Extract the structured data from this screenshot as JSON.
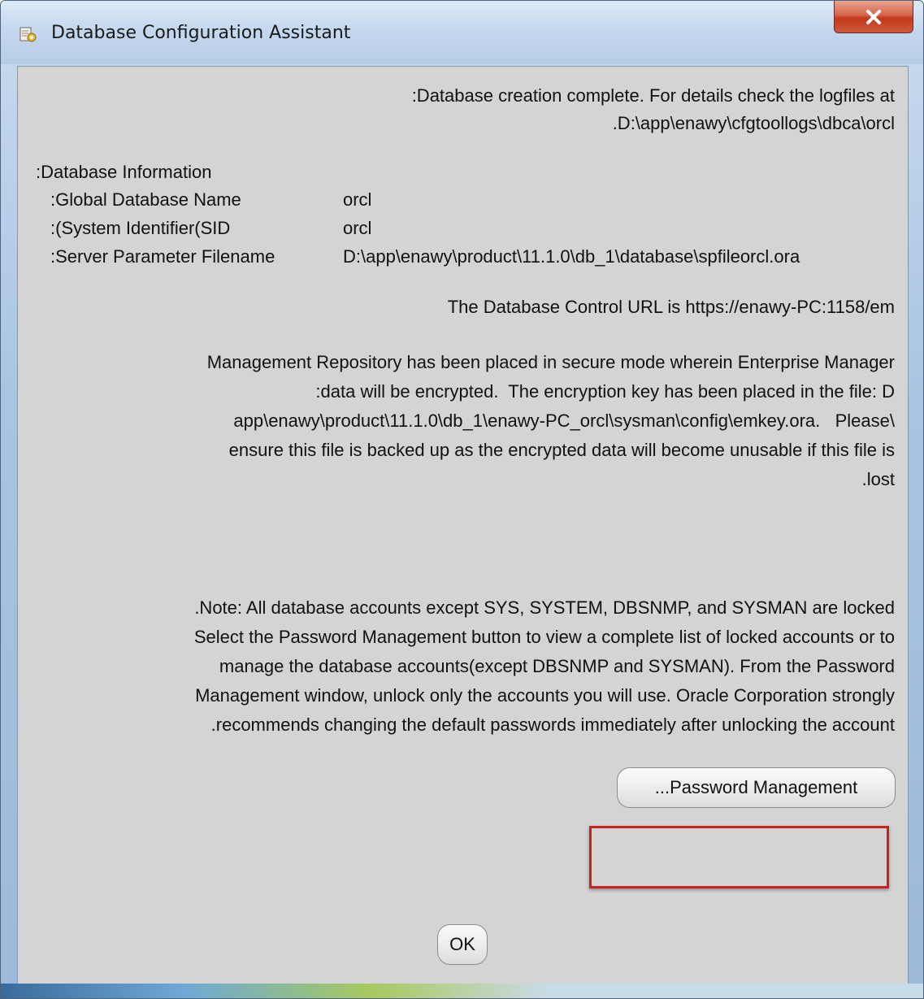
{
  "window": {
    "title": "Database Configuration Assistant",
    "close_icon": "close-icon"
  },
  "completion": {
    "line1": ":Database creation complete. For details check the logfiles at",
    "line2": ".D:\\app\\enawy\\cfgtoollogs\\dbca\\orcl"
  },
  "database_info": {
    "heading": ":Database Information",
    "rows": [
      {
        "label": ":Global Database Name",
        "value": "orcl"
      },
      {
        "label": ":(System Identifier(SID",
        "value": "orcl"
      },
      {
        "label": ":Server Parameter Filename",
        "value": "D:\\app\\enawy\\product\\11.1.0\\db_1\\database\\spfileorcl.ora"
      }
    ]
  },
  "control_url": "The Database Control URL is https://enawy-PC:1158/em",
  "repository_message": [
    "Management Repository has been placed in secure mode wherein Enterprise Manager",
    ":data will be encrypted.  The encryption key has been placed in the file: D",
    "app\\enawy\\product\\11.1.0\\db_1\\enawy-PC_orcl\\sysman\\config\\emkey.ora.   Please\\",
    "ensure this file is backed up as the encrypted data will become unusable if this file is",
    ".lost"
  ],
  "note_message": [
    ".Note: All database accounts except SYS, SYSTEM, DBSNMP, and SYSMAN are locked",
    "Select the Password Management button to view a complete list of locked accounts or to",
    "manage the database accounts(except DBSNMP and SYSMAN). From the Password",
    "Management window, unlock only the accounts you will use. Oracle Corporation strongly",
    ".recommends changing the default passwords immediately after unlocking the account"
  ],
  "buttons": {
    "password_management": "...Password Management",
    "ok": "OK"
  },
  "colors": {
    "highlight": "#cc1f1f",
    "client_background": "#d4d4d4"
  }
}
